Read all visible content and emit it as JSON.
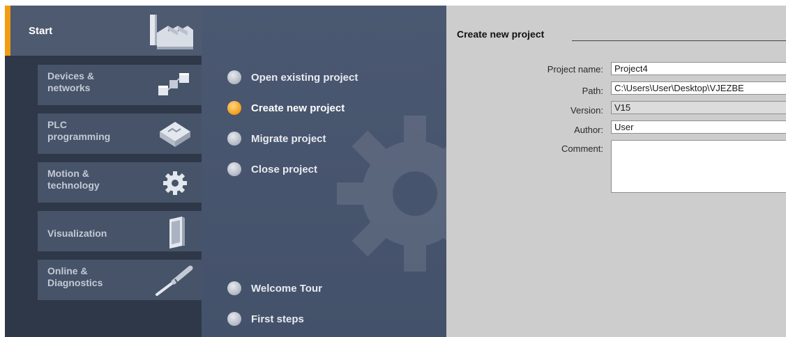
{
  "nav": {
    "start_label": "Start",
    "tiles": [
      {
        "label": "Devices &\nnetworks",
        "icon": "network-devices-icon"
      },
      {
        "label": "PLC\nprogramming",
        "icon": "plc-programming-icon"
      },
      {
        "label": "Motion &\ntechnology",
        "icon": "motion-gear-icon"
      },
      {
        "label": "Visualization",
        "icon": "panel-screen-icon"
      },
      {
        "label": "Online &\nDiagnostics",
        "icon": "diagnostics-probe-icon"
      }
    ]
  },
  "actions": [
    {
      "label": "Open existing project"
    },
    {
      "label": "Create new project",
      "active": true
    },
    {
      "label": "Migrate project"
    },
    {
      "label": "Close project"
    },
    {
      "label": "Welcome Tour"
    },
    {
      "label": "First steps"
    }
  ],
  "form": {
    "title": "Create new project",
    "fields": {
      "project_name": {
        "label": "Project name:",
        "value": "Project4"
      },
      "path": {
        "label": "Path:",
        "value": "C:\\Users\\User\\Desktop\\VJEZBE"
      },
      "version": {
        "label": "Version:",
        "value": "V15"
      },
      "author": {
        "label": "Author:",
        "value": "User"
      },
      "comment": {
        "label": "Comment:",
        "value": ""
      }
    }
  },
  "colors": {
    "accent": "#f39c12",
    "nav_bg": "#2f3848",
    "tile_bg": "#465368",
    "panel_bg": "#4b5871",
    "form_bg": "#cdcdcd"
  }
}
